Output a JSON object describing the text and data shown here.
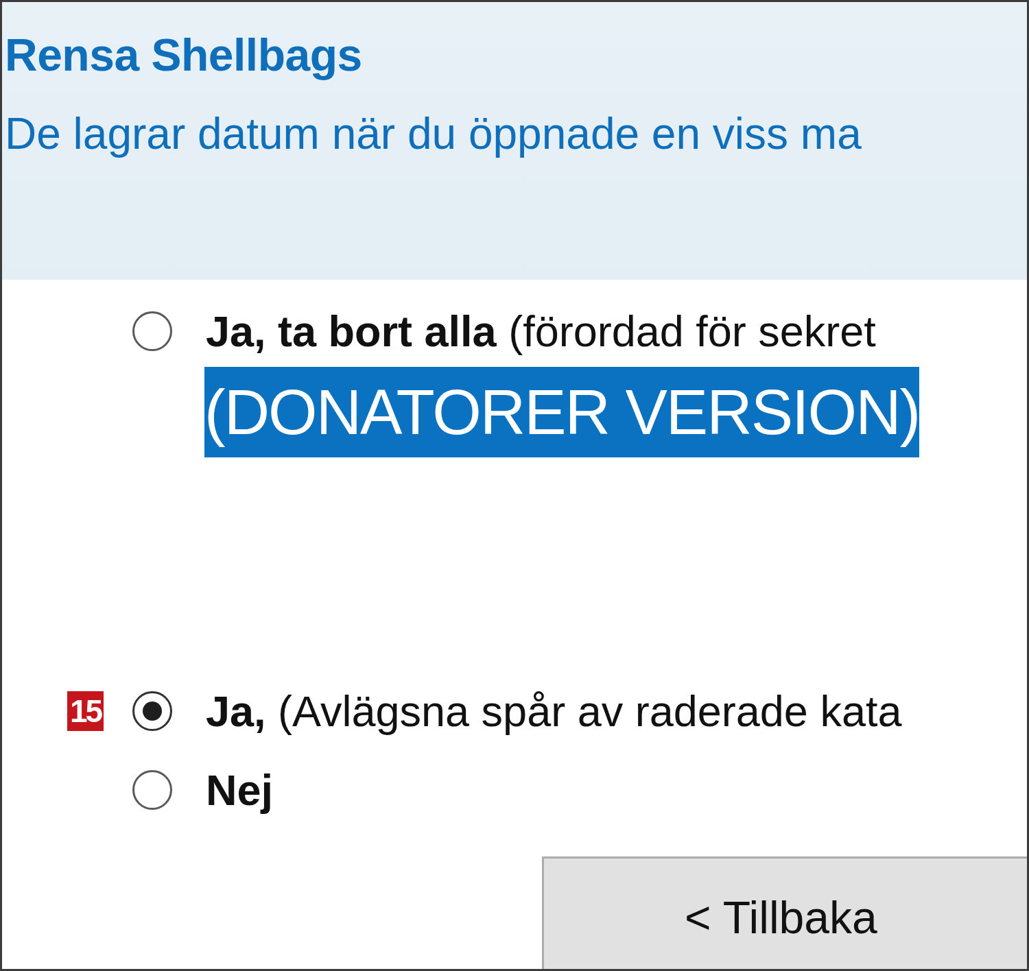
{
  "header": {
    "title": "Rensa Shellbags",
    "subtitle": "De lagrar datum när du öppnade en viss ma"
  },
  "options": [
    {
      "label": "Ja, ta bort alla",
      "detail": "(förordad för sekret",
      "selected": false,
      "note": "(DONATORER VERSION)"
    },
    {
      "label": "Ja,",
      "detail": "(Avlägsna spår av raderade kata",
      "selected": true,
      "badge": "15"
    },
    {
      "label": "Nej",
      "selected": false
    }
  ],
  "buttons": [
    {
      "label": "< Tillbaka"
    }
  ]
}
